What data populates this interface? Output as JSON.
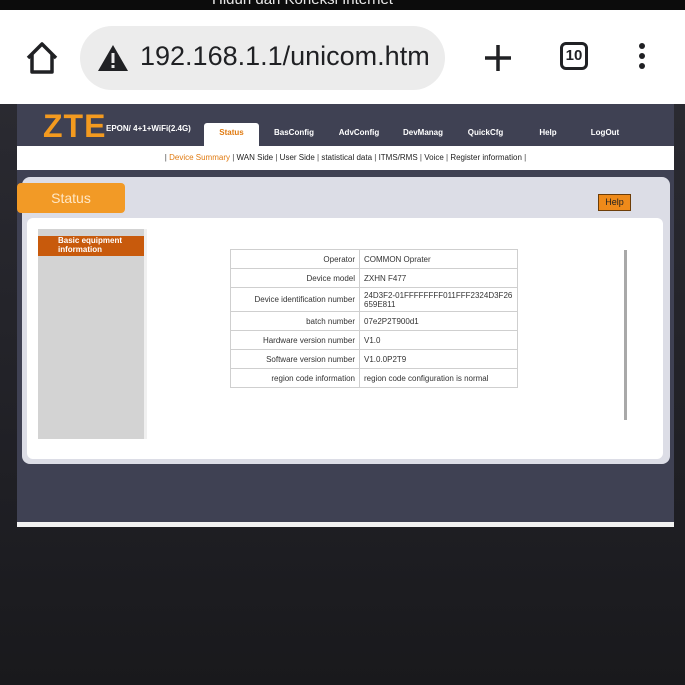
{
  "browser": {
    "status_text": "Hiduh dan Koneksi Internet",
    "url": "192.168.1.1/unicom.htm",
    "tab_count": "10"
  },
  "router": {
    "logo": "ZTE",
    "model": "EPON/ 4+1+WiFi(2.4G)",
    "nav": [
      "Status",
      "BasConfig",
      "AdvConfig",
      "DevManag",
      "QuickCfg",
      "Help",
      "LogOut"
    ],
    "subnav": [
      "Device Summary",
      "WAN Side",
      "User Side",
      "statistical data",
      "ITMS/RMS",
      "Voice",
      "Register information"
    ],
    "status_tab": "Status",
    "help_button": "Help",
    "sidebar_item": "Basic equipment information",
    "table": [
      {
        "label": "Operator",
        "value": "COMMON Oprater"
      },
      {
        "label": "Device model",
        "value": "ZXHN F477"
      },
      {
        "label": "Device identification number",
        "value": "24D3F2-01FFFFFFFF011FFF2324D3F26659E811"
      },
      {
        "label": "batch number",
        "value": "07e2P2T900d1"
      },
      {
        "label": "Hardware version number",
        "value": "V1.0"
      },
      {
        "label": "Software version number",
        "value": "V1.0.0P2T9"
      },
      {
        "label": "region code information",
        "value": "region code configuration is normal"
      }
    ],
    "colors": {
      "accent": "#f39a1f",
      "header_bg": "#3f4153",
      "sidebar_active": "#c85a0c"
    }
  }
}
